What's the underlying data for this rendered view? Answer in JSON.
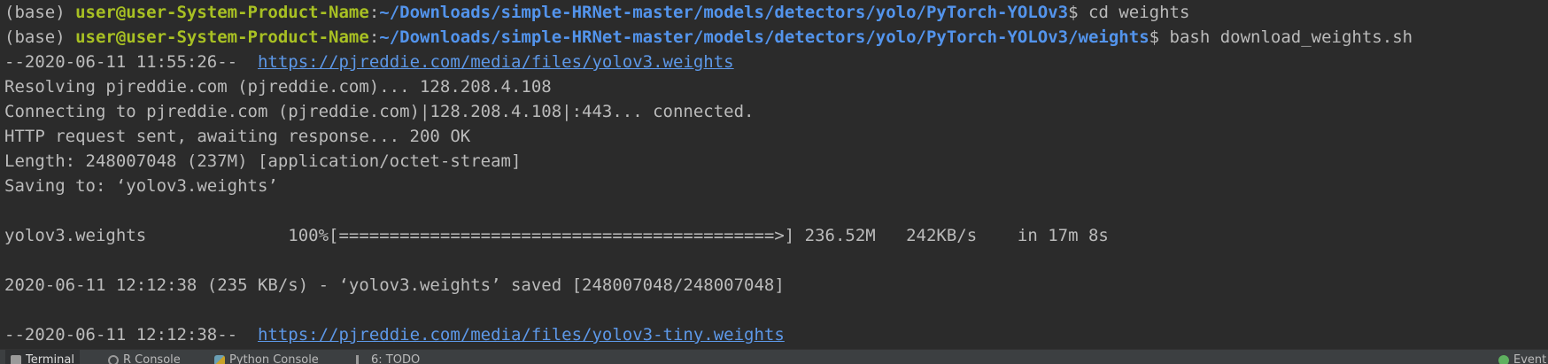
{
  "terminal": {
    "lines": [
      {
        "prefix": "(base) ",
        "user": "user@user-System-Product-Name",
        "sep": ":",
        "path": "~/Downloads/simple-HRNet-master/models/detectors/yolo/PyTorch-YOLOv3",
        "prompt_end": "$ ",
        "command": "cd weights"
      },
      {
        "prefix": "(base) ",
        "user": "user@user-System-Product-Name",
        "sep": ":",
        "path": "~/Downloads/simple-HRNet-master/models/detectors/yolo/PyTorch-YOLOv3/weights",
        "prompt_end": "$ ",
        "command": "bash download_weights.sh"
      },
      {
        "text": "--2020-06-11 11:55:26--  ",
        "link": "https://pjreddie.com/media/files/yolov3.weights"
      },
      {
        "text": "Resolving pjreddie.com (pjreddie.com)... 128.208.4.108"
      },
      {
        "text": "Connecting to pjreddie.com (pjreddie.com)|128.208.4.108|:443... connected."
      },
      {
        "text": "HTTP request sent, awaiting response... 200 OK"
      },
      {
        "text": "Length: 248007048 (237M) [application/octet-stream]"
      },
      {
        "text": "Saving to: ‘yolov3.weights’"
      },
      {
        "text": ""
      },
      {
        "text": "yolov3.weights              100%[===========================================>] 236.52M   242KB/s    in 17m 8s"
      },
      {
        "text": ""
      },
      {
        "text": "2020-06-11 12:12:38 (235 KB/s) - ‘yolov3.weights’ saved [248007048/248007048]"
      },
      {
        "text": ""
      },
      {
        "text": "--2020-06-11 12:12:38--  ",
        "link": "https://pjreddie.com/media/files/yolov3-tiny.weights"
      }
    ]
  },
  "bottom_bar": {
    "tabs": [
      {
        "label": "Terminal",
        "icon": "terminal-icon",
        "active": true
      },
      {
        "label": "R Console",
        "icon": "r-console-icon"
      },
      {
        "label": "Python Console",
        "icon": "python-console-icon"
      },
      {
        "label": "6: TODO",
        "icon": "todo-icon"
      }
    ],
    "event_log": {
      "label": "Event",
      "icon": "event-log-icon"
    }
  },
  "colors": {
    "background": "#2b2b2b",
    "text": "#bbbbbb",
    "user": "#a8c023",
    "path": "#5394ec",
    "link": "#5d98e8"
  }
}
